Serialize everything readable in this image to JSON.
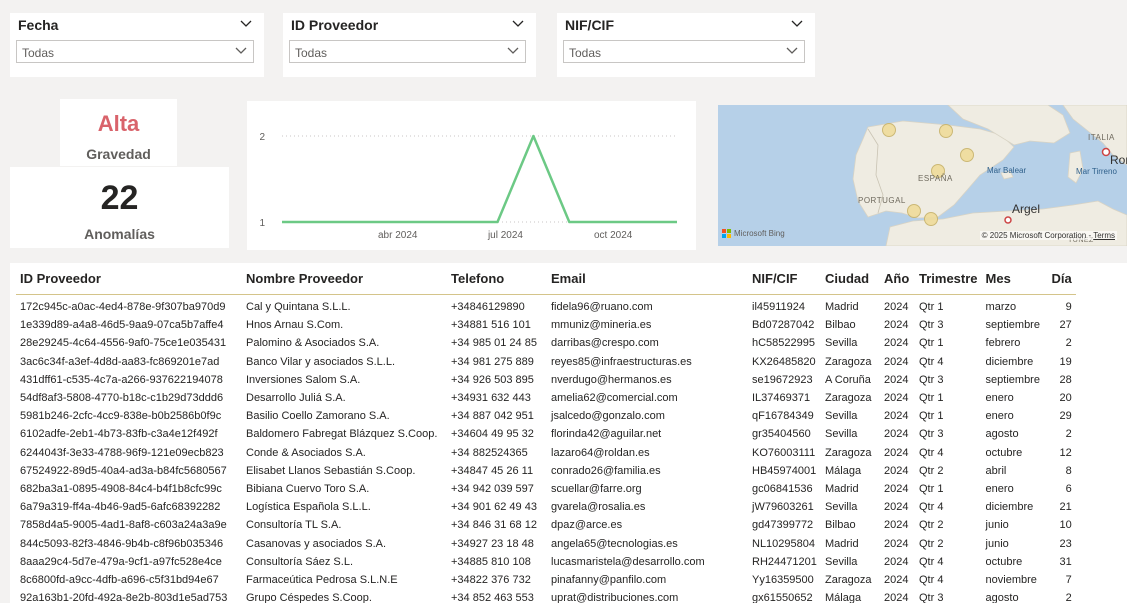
{
  "slicers": [
    {
      "title": "Fecha",
      "value": "Todas"
    },
    {
      "title": "ID Proveedor",
      "value": "Todas"
    },
    {
      "title": "NIF/CIF",
      "value": "Todas"
    }
  ],
  "kpi_severity": {
    "value": "Alta",
    "label": "Gravedad"
  },
  "kpi_anomalies": {
    "value": "22",
    "label": "Anomalías"
  },
  "chart_data": {
    "type": "line",
    "x": [
      "2024-01",
      "2024-02",
      "2024-03",
      "2024-04",
      "2024-05",
      "2024-06",
      "2024-07",
      "2024-08",
      "2024-09",
      "2024-10",
      "2024-11",
      "2024-12"
    ],
    "values": [
      1,
      1,
      1,
      1,
      1,
      1,
      1,
      2,
      1,
      1,
      1,
      1
    ],
    "xticks": [
      "abr 2024",
      "jul 2024",
      "oct 2024"
    ],
    "yticks": [
      "1",
      "2"
    ],
    "ylim": [
      1,
      2
    ],
    "grid": true,
    "color": "#6cc985"
  },
  "map": {
    "labels": {
      "portugal": "PORTUGAL",
      "espana": "ESPAÑA",
      "mar_balear": "Mar Balear",
      "mar_balear2": "",
      "argel": "Argel",
      "italia": "ITALIA",
      "roma": "Rom",
      "mar_tirreno": "Mar Tirreno",
      "tunez": "TÚNEZ"
    },
    "attribution": "© 2025 Microsoft Corporation",
    "terms": "Terms",
    "logo": "Microsoft Bing",
    "bubble_color": "#f0dc9a"
  },
  "table": {
    "headers": [
      "ID Proveedor",
      "Nombre Proveedor",
      "Telefono",
      "Email",
      "NIF/CIF",
      "Ciudad",
      "Año",
      "Trimestre",
      "Mes",
      "Día"
    ],
    "rows": [
      [
        "172c945c-a0ac-4ed4-878e-9f307ba970d9",
        "Cal y Quintana S.L.L.",
        "+34846129890",
        "fidela96@ruano.com",
        "il45911924",
        "Madrid",
        "2024",
        "Qtr 1",
        "marzo",
        "9"
      ],
      [
        "1e339d89-a4a8-46d5-9aa9-07ca5b7affe4",
        "Hnos Arnau S.Com.",
        "+34881 516 101",
        "mmuniz@mineria.es",
        "Bd07287042",
        "Bilbao",
        "2024",
        "Qtr 3",
        "septiembre",
        "27"
      ],
      [
        "28e29245-4c64-4556-9af0-75ce1e035431",
        "Palomino & Asociados S.A.",
        "+34 985 01 24 85",
        "darribas@crespo.com",
        "hC58522995",
        "Sevilla",
        "2024",
        "Qtr 1",
        "febrero",
        "2"
      ],
      [
        "3ac6c34f-a3ef-4d8d-aa83-fc869201e7ad",
        "Banco Vilar y asociados S.L.L.",
        "+34 981 275 889",
        "reyes85@infraestructuras.es",
        "KX26485820",
        "Zaragoza",
        "2024",
        "Qtr 4",
        "diciembre",
        "19"
      ],
      [
        "431dff61-c535-4c7a-a266-937622194078",
        "Inversiones Salom S.A.",
        "+34 926 503 895",
        "nverdugo@hermanos.es",
        "se19672923",
        "A Coruña",
        "2024",
        "Qtr 3",
        "septiembre",
        "28"
      ],
      [
        "54df8af3-5808-4770-b18c-c1b29d73ddd6",
        "Desarrollo Juliá S.A.",
        "+34931 632 443",
        "amelia62@comercial.com",
        "IL37469371",
        "Zaragoza",
        "2024",
        "Qtr 1",
        "enero",
        "20"
      ],
      [
        "5981b246-2cfc-4cc9-838e-b0b2586b0f9c",
        "Basilio Coello Zamorano S.A.",
        "+34 887 042 951",
        "jsalcedo@gonzalo.com",
        "qF16784349",
        "Sevilla",
        "2024",
        "Qtr 1",
        "enero",
        "29"
      ],
      [
        "6102adfe-2eb1-4b73-83fb-c3a4e12f492f",
        "Baldomero Fabregat Blázquez S.Coop.",
        "+34604 49 95 32",
        "florinda42@aguilar.net",
        "gr35404560",
        "Sevilla",
        "2024",
        "Qtr 3",
        "agosto",
        "2"
      ],
      [
        "6244043f-3e33-4788-96f9-121e09ecb823",
        "Conde & Asociados S.A.",
        "+34 882524365",
        "lazaro64@roldan.es",
        "KO76003111",
        "Zaragoza",
        "2024",
        "Qtr 4",
        "octubre",
        "12"
      ],
      [
        "67524922-89d5-40a4-ad3a-b84fc5680567",
        "Elisabet Llanos Sebastián S.Coop.",
        "+34847 45 26 11",
        "conrado26@familia.es",
        "HB45974001",
        "Málaga",
        "2024",
        "Qtr 2",
        "abril",
        "8"
      ],
      [
        "682ba3a1-0895-4908-84c4-b4f1b8cfc99c",
        "Bibiana Cuervo Toro S.A.",
        "+34 942 039 597",
        "scuellar@farre.org",
        "gc06841536",
        "Madrid",
        "2024",
        "Qtr 1",
        "enero",
        "6"
      ],
      [
        "6a79a319-ff4a-4b46-9ad5-6afc68392282",
        "Logística Española S.L.L.",
        "+34 901 62 49 43",
        "gvarela@rosalia.es",
        "jW79603261",
        "Sevilla",
        "2024",
        "Qtr 4",
        "diciembre",
        "21"
      ],
      [
        "7858d4a5-9005-4ad1-8af8-c603a24a3a9e",
        "Consultoría TL S.A.",
        "+34 846 31 68 12",
        "dpaz@arce.es",
        "gd47399772",
        "Bilbao",
        "2024",
        "Qtr 2",
        "junio",
        "10"
      ],
      [
        "844c5093-82f3-4846-9b4b-c8f96b035346",
        "Casanovas y asociados S.A.",
        "+34927 23 18 48",
        "angela65@tecnologias.es",
        "NL10295804",
        "Madrid",
        "2024",
        "Qtr 2",
        "junio",
        "23"
      ],
      [
        "8aaa29c4-5d7e-479a-9cf1-a97fc528e4ce",
        "Consultoría Sáez S.L.",
        "+34885 810 108",
        "lucasmaristela@desarrollo.com",
        "RH24471201",
        "Sevilla",
        "2024",
        "Qtr 4",
        "octubre",
        "31"
      ],
      [
        "8c6800fd-a9cc-4dfb-a696-c5f31bd94e67",
        "Farmaceútica Pedrosa S.L.N.E",
        "+34822 376 732",
        "pinafanny@panfilo.com",
        "Yy16359500",
        "Zaragoza",
        "2024",
        "Qtr 4",
        "noviembre",
        "7"
      ],
      [
        "92a163b1-20fd-492a-8e2b-803d1e5ad753",
        "Grupo Céspedes S.Coop.",
        "+34 852 463 553",
        "uprat@distribuciones.com",
        "gx61550652",
        "Málaga",
        "2024",
        "Qtr 3",
        "agosto",
        "2"
      ]
    ]
  }
}
